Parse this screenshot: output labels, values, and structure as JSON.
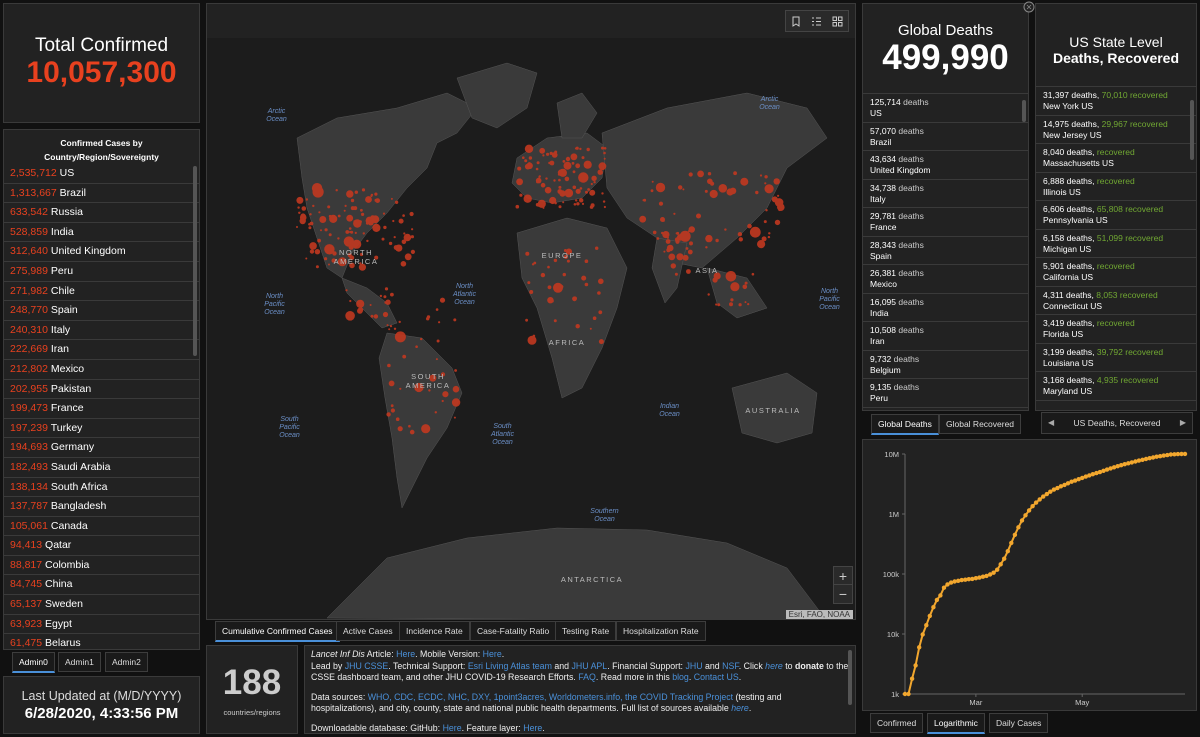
{
  "total_confirmed": {
    "label": "Total Confirmed",
    "value": "10,057,300"
  },
  "confirmed_by_country": {
    "title": "Confirmed Cases by Country/Region/Sovereignty",
    "rows": [
      {
        "count": "2,535,712",
        "name": "US"
      },
      {
        "count": "1,313,667",
        "name": "Brazil"
      },
      {
        "count": "633,542",
        "name": "Russia"
      },
      {
        "count": "528,859",
        "name": "India"
      },
      {
        "count": "312,640",
        "name": "United Kingdom"
      },
      {
        "count": "275,989",
        "name": "Peru"
      },
      {
        "count": "271,982",
        "name": "Chile"
      },
      {
        "count": "248,770",
        "name": "Spain"
      },
      {
        "count": "240,310",
        "name": "Italy"
      },
      {
        "count": "222,669",
        "name": "Iran"
      },
      {
        "count": "212,802",
        "name": "Mexico"
      },
      {
        "count": "202,955",
        "name": "Pakistan"
      },
      {
        "count": "199,473",
        "name": "France"
      },
      {
        "count": "197,239",
        "name": "Turkey"
      },
      {
        "count": "194,693",
        "name": "Germany"
      },
      {
        "count": "182,493",
        "name": "Saudi Arabia"
      },
      {
        "count": "138,134",
        "name": "South Africa"
      },
      {
        "count": "137,787",
        "name": "Bangladesh"
      },
      {
        "count": "105,061",
        "name": "Canada"
      },
      {
        "count": "94,413",
        "name": "Qatar"
      },
      {
        "count": "88,817",
        "name": "Colombia"
      },
      {
        "count": "84,745",
        "name": "China"
      },
      {
        "count": "65,137",
        "name": "Sweden"
      },
      {
        "count": "63,923",
        "name": "Egypt"
      },
      {
        "count": "61,475",
        "name": "Belarus"
      }
    ],
    "tabs": [
      "Admin0",
      "Admin1",
      "Admin2"
    ]
  },
  "last_updated": {
    "label": "Last Updated at (M/D/YYYY)",
    "value": "6/28/2020, 4:33:56 PM"
  },
  "map": {
    "attribution": "Esri, FAO, NOAA",
    "zoom_in": "+",
    "zoom_out": "−",
    "oceans": [
      {
        "text": "Arctic Ocean",
        "id": "arctic-ocean-w"
      },
      {
        "text": "Arctic Ocean",
        "id": "arctic-ocean-e"
      },
      {
        "text": "North Pacific Ocean",
        "id": "north-pacific-w"
      },
      {
        "text": "North Atlantic Ocean",
        "id": "north-atlantic"
      },
      {
        "text": "North Pacific Ocean",
        "id": "north-pacific-e"
      },
      {
        "text": "South Pacific Ocean",
        "id": "south-pacific"
      },
      {
        "text": "South Atlantic Ocean",
        "id": "south-atlantic"
      },
      {
        "text": "Indian Ocean",
        "id": "indian-ocean"
      },
      {
        "text": "Southern Ocean",
        "id": "southern-ocean"
      }
    ],
    "continents": [
      "NORTH AMERICA",
      "EUROPE",
      "ASIA",
      "AFRICA",
      "SOUTH AMERICA",
      "AUSTRALIA",
      "ANTARCTICA"
    ],
    "tabs": [
      "Cumulative Confirmed Cases",
      "Active Cases",
      "Incidence Rate",
      "Case-Fatality Ratio",
      "Testing Rate",
      "Hospitalization Rate"
    ]
  },
  "countries_count": {
    "value": "188",
    "label": "countries/regions"
  },
  "info": {
    "p1_a": "Lancet Inf Dis",
    "p1_b": " Article: ",
    "p1_here1": "Here",
    "p1_c": ". Mobile Version: ",
    "p1_here2": "Here",
    "p1_d": ".",
    "p2_a": "Lead by ",
    "p2_jhucsse": "JHU CSSE",
    "p2_b": ". Technical Support: ",
    "p2_esri": "Esri Living Atlas team",
    "p2_c": " and ",
    "p2_jhuapl": "JHU APL",
    "p2_d": ". Financial Support: ",
    "p2_jhu": "JHU",
    "p2_e": " and ",
    "p2_nsf": "NSF",
    "p2_f": ". Click ",
    "p2_here": "here",
    "p2_g": " to ",
    "p2_donate": "donate",
    "p2_h": " to the CSSE dashboard team, and other JHU COVID-19 Research Efforts. ",
    "p2_faq": "FAQ",
    "p2_i": ". Read more in this ",
    "p2_blog": "blog",
    "p2_j": ". ",
    "p2_contact": "Contact US",
    "p2_k": ".",
    "p3_a": "Data sources: ",
    "p3_links": "WHO, CDC, ECDC, NHC, DXY, 1point3acres, Worldometers.info, the COVID Tracking Project",
    "p3_b": " (testing and hospitalizations), and city, county, state and national public health departments. Full list of sources available ",
    "p3_here": "here",
    "p3_c": ".",
    "p4_a": "Downloadable database: GitHub: ",
    "p4_here1": "Here",
    "p4_b": ". Feature layer: ",
    "p4_here2": "Here",
    "p4_c": "."
  },
  "global_deaths": {
    "label": "Global Deaths",
    "value": "499,990",
    "rows": [
      {
        "count": "125,714",
        "name": "US"
      },
      {
        "count": "57,070",
        "name": "Brazil"
      },
      {
        "count": "43,634",
        "name": "United Kingdom"
      },
      {
        "count": "34,738",
        "name": "Italy"
      },
      {
        "count": "29,781",
        "name": "France"
      },
      {
        "count": "28,343",
        "name": "Spain"
      },
      {
        "count": "26,381",
        "name": "Mexico"
      },
      {
        "count": "16,095",
        "name": "India"
      },
      {
        "count": "10,508",
        "name": "Iran"
      },
      {
        "count": "9,732",
        "name": "Belgium"
      },
      {
        "count": "9,135",
        "name": "Peru"
      }
    ],
    "deaths_word": " deaths",
    "tabs": [
      "Global Deaths",
      "Global Recovered"
    ]
  },
  "us_state": {
    "title1": "US State Level",
    "title2": "Deaths, Recovered",
    "rows": [
      {
        "deaths": "31,397",
        "recovered": "70,010",
        "name": "New York US"
      },
      {
        "deaths": "14,975",
        "recovered": "29,967",
        "name": "New Jersey US"
      },
      {
        "deaths": "8,040",
        "recovered": "",
        "name": "Massachusetts US"
      },
      {
        "deaths": "6,888",
        "recovered": "",
        "name": "Illinois US"
      },
      {
        "deaths": "6,606",
        "recovered": "65,808",
        "name": "Pennsylvania US"
      },
      {
        "deaths": "6,158",
        "recovered": "51,099",
        "name": "Michigan US"
      },
      {
        "deaths": "5,901",
        "recovered": "",
        "name": "California US"
      },
      {
        "deaths": "4,311",
        "recovered": "8,053",
        "name": "Connecticut US"
      },
      {
        "deaths": "3,419",
        "recovered": "",
        "name": "Florida US"
      },
      {
        "deaths": "3,199",
        "recovered": "39,792",
        "name": "Louisiana US"
      },
      {
        "deaths": "3,168",
        "recovered": "4,935",
        "name": "Maryland US"
      }
    ],
    "deaths_word": " deaths, ",
    "recovered_word": " recovered",
    "pager_label": "US Deaths, Recovered",
    "prev": "◀",
    "next": "▶"
  },
  "chart_data": {
    "type": "line",
    "scale": "log",
    "yticks": [
      "10M",
      "1M",
      "100k",
      "10k",
      "1k"
    ],
    "ytick_values": [
      10000000,
      1000000,
      100000,
      10000,
      1000
    ],
    "xticks": [
      "Mar",
      "May"
    ],
    "ylim": [
      1000,
      10000000
    ],
    "color": "#f2a72e",
    "x": [
      0,
      2,
      4,
      6,
      8,
      10,
      12,
      14,
      16,
      18,
      20,
      22,
      24,
      26,
      28,
      30,
      32,
      34,
      36,
      38,
      40,
      42,
      44,
      46,
      48,
      50,
      52,
      54,
      56,
      58,
      60,
      62,
      64,
      66,
      68,
      70,
      72,
      74,
      76,
      78,
      80,
      82,
      84,
      86,
      88,
      90,
      92,
      94,
      96,
      98,
      100,
      102,
      104,
      106,
      108,
      110,
      112,
      114,
      116,
      118,
      120,
      122,
      124,
      126,
      128,
      130,
      132,
      134,
      136,
      138,
      140,
      142,
      144,
      146,
      148,
      150,
      152,
      154,
      156,
      158
    ],
    "values": [
      555,
      900,
      1800,
      3000,
      6000,
      9800,
      14000,
      20000,
      28000,
      37000,
      44000,
      59000,
      67000,
      72000,
      75000,
      77000,
      79000,
      80500,
      82000,
      83000,
      85000,
      87000,
      90000,
      93000,
      98000,
      105000,
      118000,
      145000,
      180000,
      240000,
      330000,
      450000,
      600000,
      780000,
      950000,
      1150000,
      1350000,
      1550000,
      1750000,
      1950000,
      2150000,
      2350000,
      2550000,
      2700000,
      2900000,
      3050000,
      3250000,
      3450000,
      3600000,
      3800000,
      4000000,
      4200000,
      4400000,
      4600000,
      4800000,
      5000000,
      5250000,
      5500000,
      5750000,
      6000000,
      6250000,
      6500000,
      6750000,
      7000000,
      7250000,
      7500000,
      7750000,
      8000000,
      8250000,
      8500000,
      8750000,
      9000000,
      9200000,
      9400000,
      9600000,
      9800000,
      9900000,
      9950000,
      10000000,
      10057300
    ],
    "xtick_positions": [
      40,
      100
    ]
  },
  "chart_tabs": [
    "Confirmed",
    "Logarithmic",
    "Daily Cases"
  ]
}
